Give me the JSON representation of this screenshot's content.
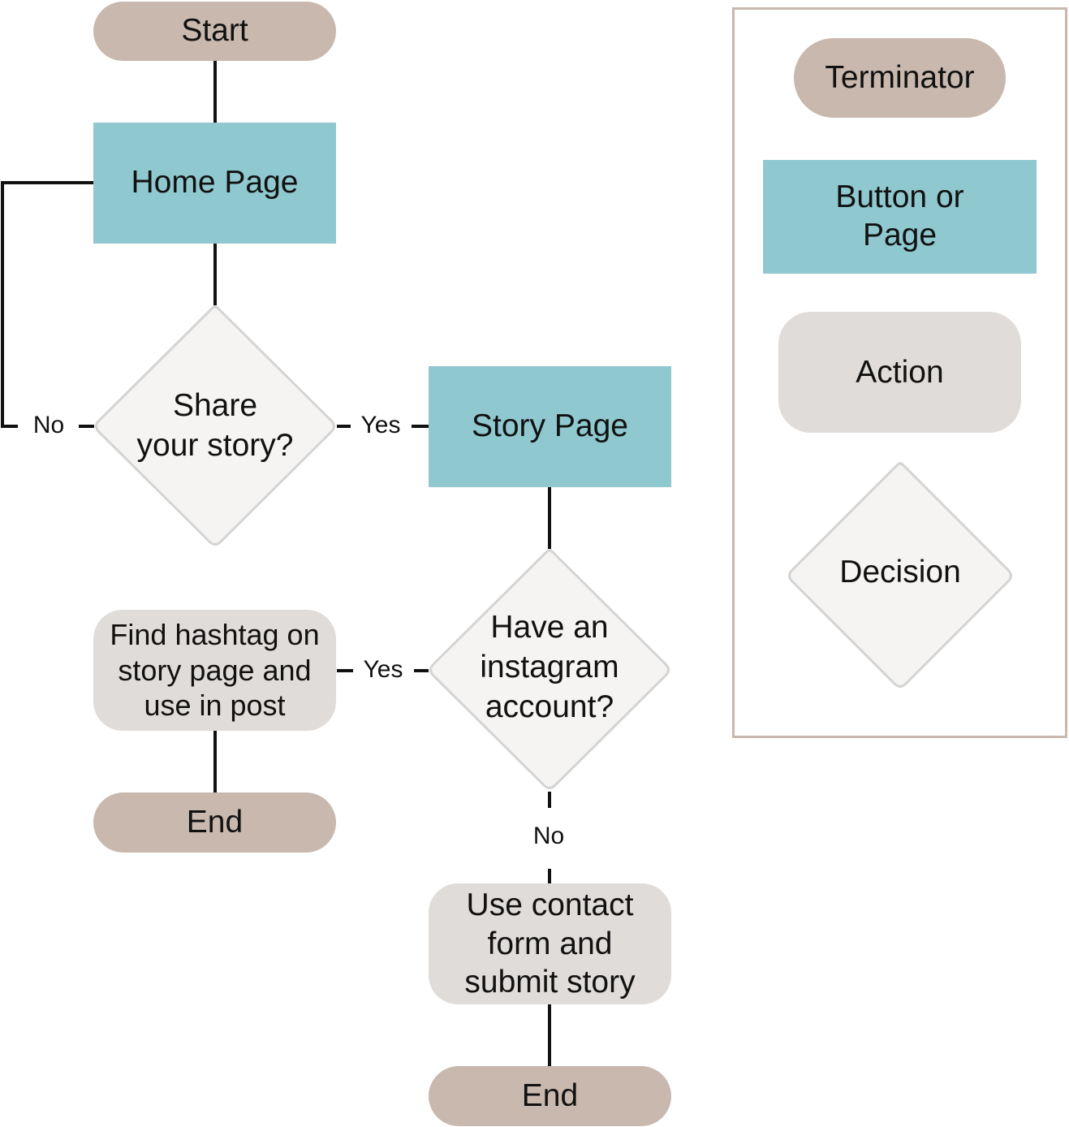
{
  "colors": {
    "terminator": "#c8b8ae",
    "page": "#8fc8cf",
    "action": "#e0dcd9",
    "decision_fill": "#f5f4f2",
    "decision_stroke": "#d4d4d4",
    "line": "#111111"
  },
  "nodes": {
    "start": "Start",
    "home_page": "Home Page",
    "share_decision": "Share\nyour story?",
    "story_page": "Story Page",
    "instagram_decision": "Have an\ninstagram\naccount?",
    "find_hashtag": "Find hashtag on\nstory page and\nuse in post",
    "end_left": "End",
    "contact_form": "Use contact\nform and\nsubmit story",
    "end_bottom": "End"
  },
  "edge_labels": {
    "share_no": "No",
    "share_yes": "Yes",
    "instagram_yes": "Yes",
    "instagram_no": "No"
  },
  "legend": {
    "terminator": "Terminator",
    "button_or_page": "Button or\nPage",
    "action": "Action",
    "decision": "Decision"
  }
}
